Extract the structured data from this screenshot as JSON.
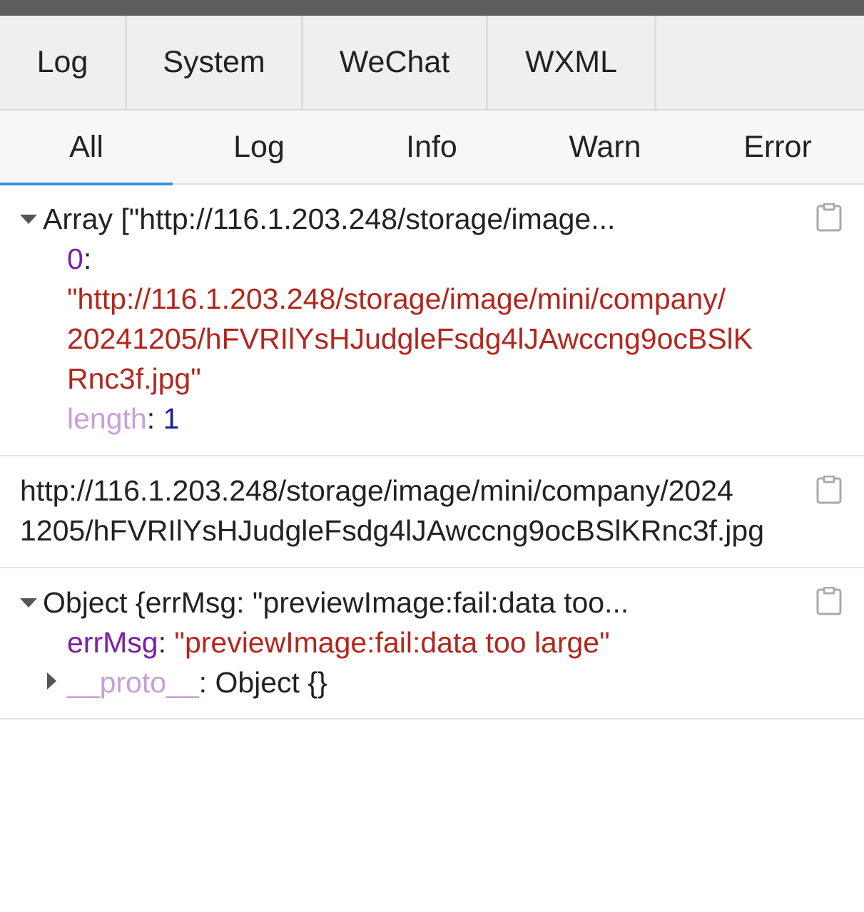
{
  "main_tabs": [
    {
      "label": "Log"
    },
    {
      "label": "System"
    },
    {
      "label": "WeChat"
    },
    {
      "label": "WXML"
    }
  ],
  "sub_tabs": [
    {
      "label": "All",
      "active": true
    },
    {
      "label": "Log"
    },
    {
      "label": "Info"
    },
    {
      "label": "Warn"
    },
    {
      "label": "Error"
    }
  ],
  "entries": {
    "array": {
      "summary": "Array [\"http://116.1.203.248/storage/image...",
      "index_key": "0",
      "colon": ":",
      "value_lines": [
        "\"http://116.1.203.248/storage/image/mini/company/",
        "20241205/hFVRIlYsHJudgleFsdg4lJAwccng9ocBSlK",
        "Rnc3f.jpg\""
      ],
      "length_key": "length",
      "length_value": "1"
    },
    "url": {
      "lines": [
        "http://116.1.203.248/storage/image/mini/company/2024",
        "1205/hFVRIlYsHJudgleFsdg4lJAwccng9ocBSlKRnc3f.jpg"
      ]
    },
    "object": {
      "summary": "Object {errMsg: \"previewImage:fail:data too...",
      "errmsg_key": "errMsg",
      "colon": ":",
      "errmsg_value": "\"previewImage:fail:data too large\"",
      "proto_key": "__proto__",
      "proto_value": ": Object {}"
    }
  },
  "icons": {
    "copy": "clipboard-icon",
    "expanded": "caret-down-icon",
    "collapsed": "caret-right-icon"
  },
  "colors": {
    "active_tab_underline": "#3a8ee6",
    "string": "#b3261e",
    "key": "#7b1fa2",
    "number": "#1a1aa6"
  }
}
